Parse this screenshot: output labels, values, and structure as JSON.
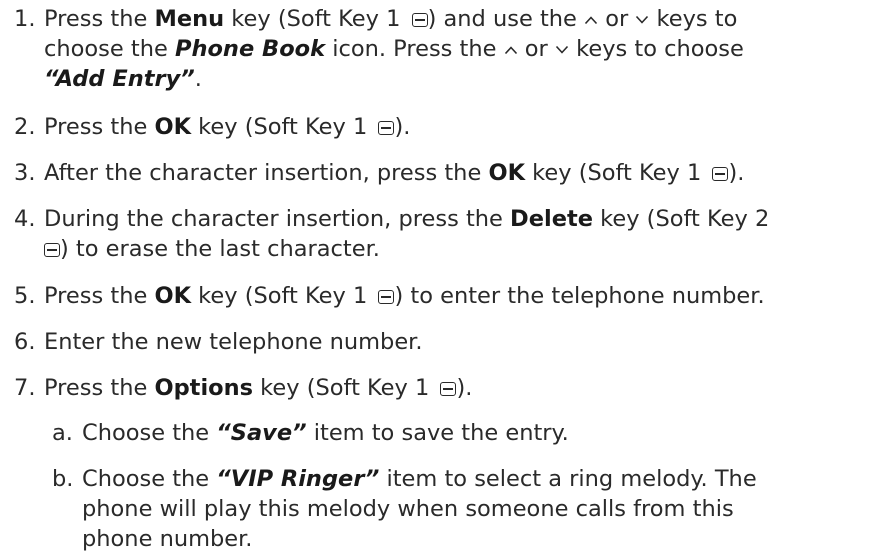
{
  "steps": [
    {
      "num": "1.",
      "lines": [
        [
          "Press the ",
          "Menu",
          " key (Soft Key 1 ",
          ") and use the ",
          " or ",
          " keys to"
        ],
        [
          "choose the ",
          "Phone Book",
          " icon. Press the ",
          " or ",
          " keys to choose"
        ],
        [
          "“Add Entry”",
          "."
        ]
      ]
    },
    {
      "num": "2.",
      "parts": [
        "Press the ",
        "OK",
        " key (Soft Key 1 ",
        ")."
      ]
    },
    {
      "num": "3.",
      "parts": [
        "After the character insertion, press the ",
        "OK",
        " key (Soft Key 1 ",
        ")."
      ]
    },
    {
      "num": "4.",
      "line1": [
        "During the character insertion, press the ",
        "Delete",
        " key (Soft Key 2"
      ],
      "line2": [
        ") to erase the last character."
      ]
    },
    {
      "num": "5.",
      "parts": [
        "Press the ",
        "OK",
        " key (Soft Key 1 ",
        ") to enter the telephone number."
      ]
    },
    {
      "num": "6.",
      "text": "Enter the new telephone number."
    },
    {
      "num": "7.",
      "parts": [
        "Press the ",
        "Options",
        " key (Soft Key 1 ",
        ")."
      ]
    }
  ],
  "substeps": [
    {
      "num": "a.",
      "parts": [
        "Choose the ",
        "“Save”",
        " item to save the entry."
      ]
    },
    {
      "num": "b.",
      "line1": [
        "Choose the ",
        "“VIP Ringer”",
        " item to select a ring melody. The"
      ],
      "line2": "phone will play this melody when someone calls from this",
      "line3": "phone number."
    }
  ],
  "icons": {
    "soft_key": "soft-key-icon",
    "up_arrow": "up-arrow-icon",
    "down_arrow": "down-arrow-icon"
  }
}
